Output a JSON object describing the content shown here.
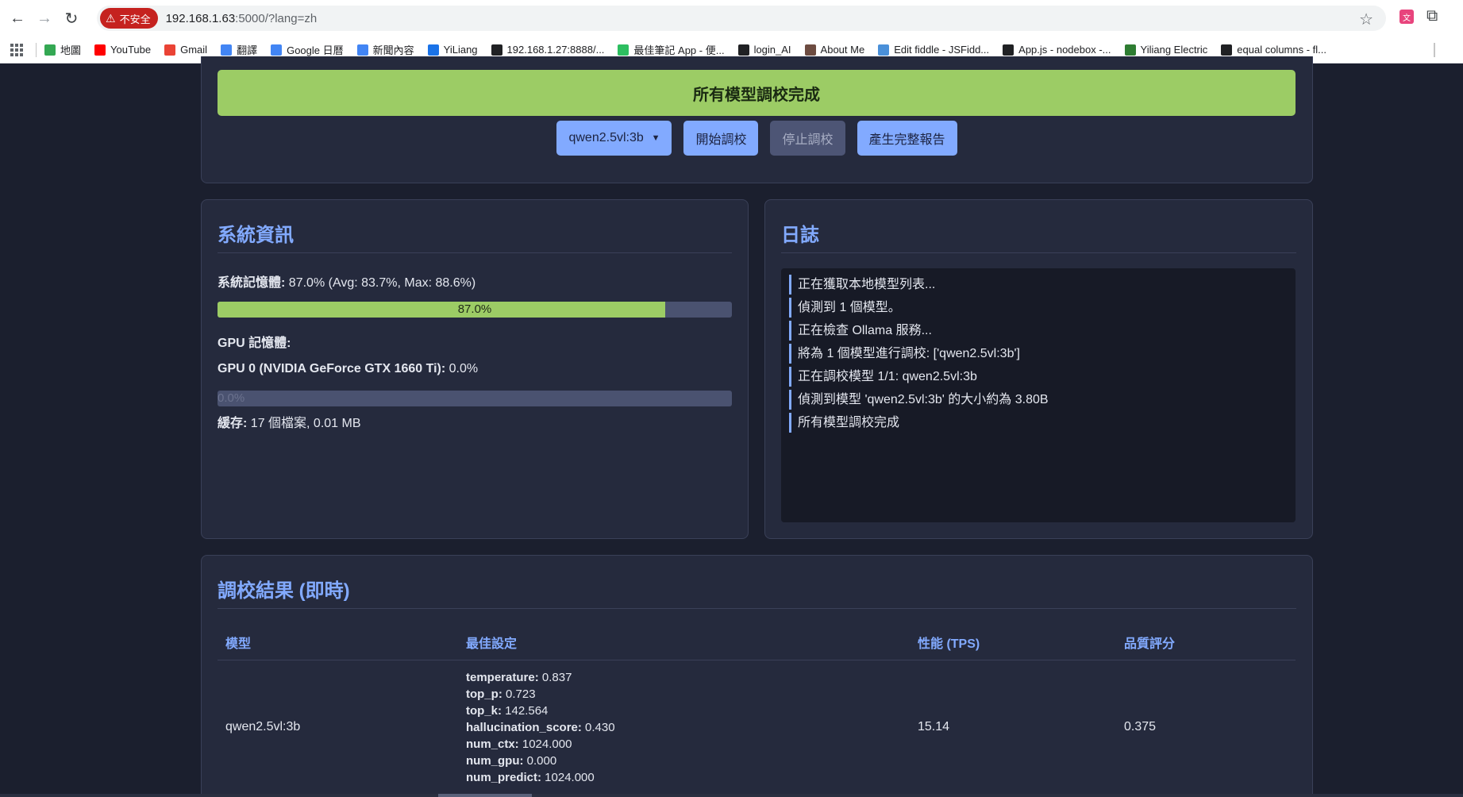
{
  "browser": {
    "insecure_label": "不安全",
    "url_host": "192.168.1.63",
    "url_rest": ":5000/?lang=zh",
    "bookmarks": [
      {
        "label": "地圖",
        "icon": "maps-icon",
        "color": "#34a853"
      },
      {
        "label": "YouTube",
        "icon": "youtube-icon",
        "color": "#ff0000"
      },
      {
        "label": "Gmail",
        "icon": "gmail-icon",
        "color": "#ea4335"
      },
      {
        "label": "翻譯",
        "icon": "translate-icon",
        "color": "#4285f4"
      },
      {
        "label": "Google 日曆",
        "icon": "calendar-icon",
        "color": "#4285f4"
      },
      {
        "label": "新聞內容",
        "icon": "news-icon",
        "color": "#4285f4"
      },
      {
        "label": "YiLiang",
        "icon": "yiliang-icon",
        "color": "#1a73e8"
      },
      {
        "label": "192.168.1.27:8888/...",
        "icon": "globe-icon",
        "color": "#202124"
      },
      {
        "label": "最佳筆記 App - 便...",
        "icon": "evernote-icon",
        "color": "#2dbe60"
      },
      {
        "label": "login_AI",
        "icon": "globe-icon",
        "color": "#202124"
      },
      {
        "label": "About Me",
        "icon": "profile-icon",
        "color": "#6d4c41"
      },
      {
        "label": "Edit fiddle - JSFidd...",
        "icon": "cloud-icon",
        "color": "#4a90d9"
      },
      {
        "label": "App.js - nodebox -...",
        "icon": "square-icon",
        "color": "#202124"
      },
      {
        "label": "Yiliang Electric",
        "icon": "z-icon",
        "color": "#2e7d32"
      },
      {
        "label": "equal columns - fl...",
        "icon": "codepen-icon",
        "color": "#202124"
      }
    ]
  },
  "status": {
    "banner": "所有模型調校完成",
    "model_select": "qwen2.5vl:3b",
    "start_button": "開始調校",
    "stop_button": "停止調校",
    "report_button": "產生完整報告"
  },
  "system": {
    "title": "系統資訊",
    "mem_label": "系統記憶體:",
    "mem_value": "87.0% (Avg: 83.7%, Max: 88.6%)",
    "mem_percent": 87.0,
    "mem_bar_text": "87.0%",
    "gpu_heading": "GPU 記憶體:",
    "gpu0_label": "GPU 0 (NVIDIA GeForce GTX 1660 Ti):",
    "gpu0_value": "0.0%",
    "gpu0_percent": 0.0,
    "gpu0_bar_text": "0.0%",
    "cache_label": "緩存:",
    "cache_value": "17 個檔案, 0.01 MB"
  },
  "log": {
    "title": "日誌",
    "lines": [
      "正在獲取本地模型列表...",
      "偵測到 1 個模型。",
      "正在檢查 Ollama 服務...",
      "將為 1 個模型進行調校: ['qwen2.5vl:3b']",
      "正在調校模型 1/1: qwen2.5vl:3b",
      "偵測到模型 'qwen2.5vl:3b' 的大小約為 3.80B",
      "所有模型調校完成"
    ]
  },
  "results": {
    "title": "調校結果 (即時)",
    "headers": [
      "模型",
      "最佳設定",
      "性能 (TPS)",
      "品質評分"
    ],
    "rows": [
      {
        "model": "qwen2.5vl:3b",
        "settings": [
          {
            "key": "temperature:",
            "value": "0.837"
          },
          {
            "key": "top_p:",
            "value": "0.723"
          },
          {
            "key": "top_k:",
            "value": "142.564"
          },
          {
            "key": "hallucination_score:",
            "value": "0.430"
          },
          {
            "key": "num_ctx:",
            "value": "1024.000"
          },
          {
            "key": "num_gpu:",
            "value": "0.000"
          },
          {
            "key": "num_predict:",
            "value": "1024.000"
          }
        ],
        "tps": "15.14",
        "quality": "0.375"
      }
    ]
  },
  "colors": {
    "accent": "#82aaff",
    "success": "#9ccc65",
    "background": "#1b1f2e",
    "panel": "#252a3d"
  }
}
